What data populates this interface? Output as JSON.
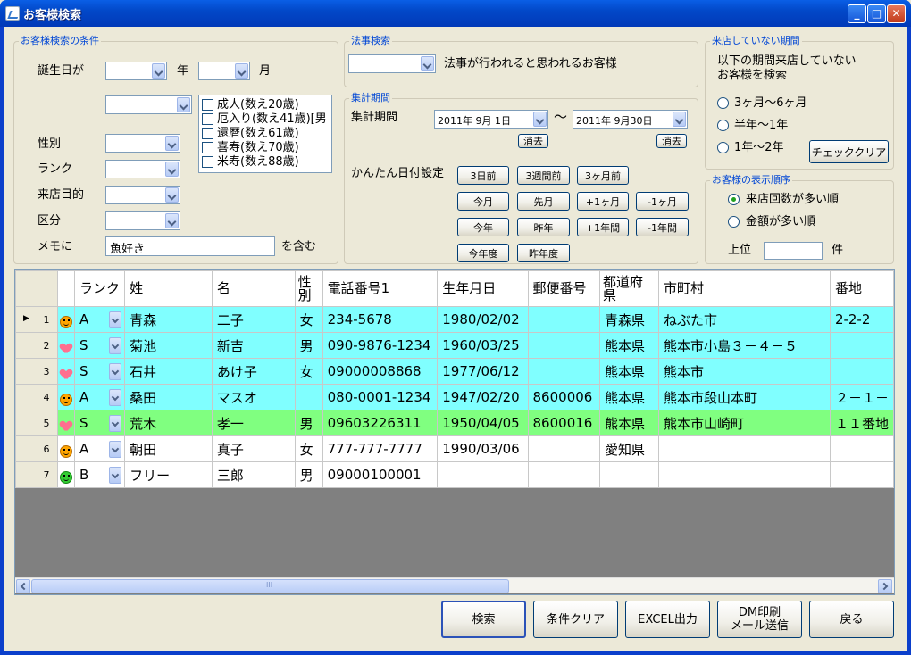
{
  "window": {
    "title": "お客様検索"
  },
  "conditions": {
    "group_label": "お客様検索の条件",
    "birthday_label": "誕生日が",
    "year_label": "年",
    "month_label": "月",
    "gender_label": "性別",
    "rank_label": "ランク",
    "purpose_label": "来店目的",
    "category_label": "区分",
    "memo_label": "メモに",
    "memo_value": "魚好き",
    "memo_suffix": "を含む",
    "age_options": [
      "成人(数え20歳)",
      "厄入り(数え41歳)[男",
      "還暦(数え61歳)",
      "喜寿(数え70歳)",
      "米寿(数え88歳)"
    ]
  },
  "memorial": {
    "group_label": "法事検索",
    "description": "法事が行われると思われるお客様"
  },
  "period": {
    "group_label": "集計期間",
    "label": "集計期間",
    "start_date": "2011年 9月 1日",
    "tilde": "〜",
    "end_date": "2011年 9月30日",
    "clear_label": "消去",
    "quick_label": "かんたん日付設定",
    "quick_buttons": [
      [
        "3日前",
        "3週間前",
        "3ヶ月前"
      ],
      [
        "今月",
        "先月",
        "+1ヶ月",
        "-1ヶ月"
      ],
      [
        "今年",
        "昨年",
        "+1年間",
        "-1年間"
      ],
      [
        "今年度",
        "昨年度"
      ]
    ]
  },
  "absence": {
    "group_label": "来店していない期間",
    "description_line1": "以下の期間来店していない",
    "description_line2": "お客様を検索",
    "options": [
      "3ヶ月〜6ヶ月",
      "半年〜1年",
      "1年〜2年"
    ],
    "check_clear_label": "チェッククリア"
  },
  "order": {
    "group_label": "お客様の表示順序",
    "options": [
      "来店回数が多い順",
      "金額が多い順"
    ],
    "selected": 0,
    "top_label": "上位",
    "count_unit": "件"
  },
  "grid": {
    "headers": [
      "",
      "",
      "ランク",
      "姓",
      "名",
      "性\n別",
      "電話番号1",
      "生年月日",
      "郵便番号",
      "都道府\n県",
      "市町村",
      "番地"
    ],
    "rows": [
      {
        "num": "1",
        "icon": "smiley-icon",
        "color": "cyan",
        "rank": "A",
        "last": "青森",
        "first": "二子",
        "gender": "女",
        "phone": "234-5678",
        "birth": "1980/02/02",
        "zip": "",
        "pref": "青森県",
        "city": "ねぶた市",
        "addr": "2-2-2"
      },
      {
        "num": "2",
        "icon": "heart-icon",
        "color": "cyan",
        "rank": "S",
        "last": "菊池",
        "first": "新吉",
        "gender": "男",
        "phone": "090-9876-1234",
        "birth": "1960/03/25",
        "zip": "",
        "pref": "熊本県",
        "city": "熊本市小島３－４－５",
        "addr": ""
      },
      {
        "num": "3",
        "icon": "heart-icon",
        "color": "cyan",
        "rank": "S",
        "last": "石井",
        "first": "あけ子",
        "gender": "女",
        "phone": "09000008868",
        "birth": "1977/06/12",
        "zip": "",
        "pref": "熊本県",
        "city": "熊本市",
        "addr": ""
      },
      {
        "num": "4",
        "icon": "smiley-icon",
        "color": "cyan",
        "rank": "A",
        "last": "桑田",
        "first": "マスオ",
        "gender": "",
        "phone": "080-0001-1234",
        "birth": "1947/02/20",
        "zip": "8600006",
        "pref": "熊本県",
        "city": "熊本市段山本町",
        "addr": "２－１－"
      },
      {
        "num": "5",
        "icon": "heart-icon",
        "color": "green",
        "rank": "S",
        "last": "荒木",
        "first": "孝一",
        "gender": "男",
        "phone": "09603226311",
        "birth": "1950/04/05",
        "zip": "8600016",
        "pref": "熊本県",
        "city": "熊本市山崎町",
        "addr": "１１番地"
      },
      {
        "num": "6",
        "icon": "smiley-icon",
        "color": "white",
        "rank": "A",
        "last": "朝田",
        "first": "真子",
        "gender": "女",
        "phone": "777-777-7777",
        "birth": "1990/03/06",
        "zip": "",
        "pref": "愛知県",
        "city": "",
        "addr": ""
      },
      {
        "num": "7",
        "icon": "green-smiley-icon",
        "color": "white",
        "rank": "B",
        "last": "フリー",
        "first": "三郎",
        "gender": "男",
        "phone": "09000100001",
        "birth": "",
        "zip": "",
        "pref": "",
        "city": "",
        "addr": ""
      }
    ]
  },
  "scroll": {
    "grip": "III"
  },
  "actions": {
    "search": "検索",
    "clear": "条件クリア",
    "excel": "EXCEL出力",
    "dm_line1": "DM印刷",
    "dm_line2": "メール送信",
    "back": "戻る"
  },
  "colors": {
    "cyan": "#80ffff",
    "green": "#80ff80",
    "white": "#ffffff",
    "title_bar": "#0248c8"
  }
}
